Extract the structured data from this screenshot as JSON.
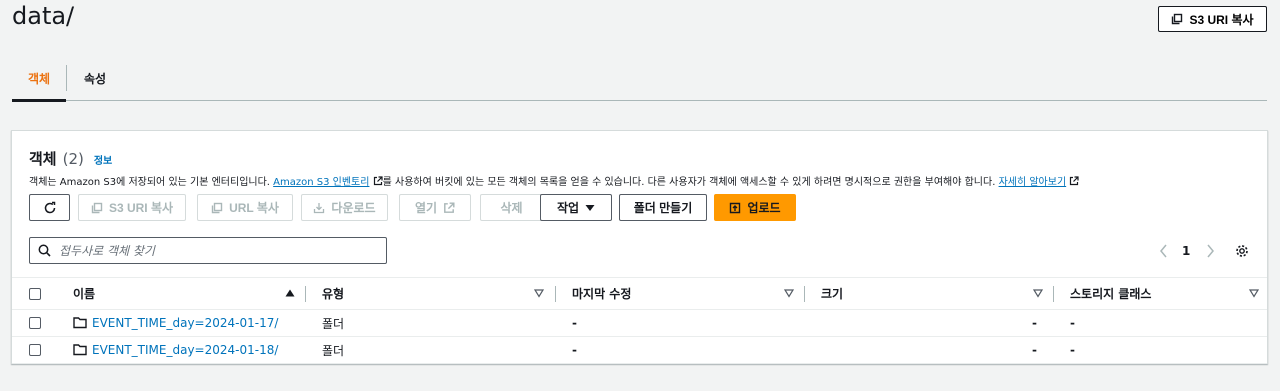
{
  "header": {
    "title": "data/",
    "copy_uri_label": "S3 URI 복사"
  },
  "tabs": [
    {
      "label": "객체",
      "active": true
    },
    {
      "label": "속성",
      "active": false
    }
  ],
  "objects_panel": {
    "title": "객체",
    "count": "(2)",
    "info_label": "정보",
    "description_prefix": "객체는 Amazon S3에 저장되어 있는 기본 엔터티입니다. ",
    "inventory_link": "Amazon S3 인벤토리",
    "description_mid": "를 사용하여 버킷에 있는 모든 객체의 목록을 얻을 수 있습니다. 다른 사용자가 객체에 액세스할 수 있게 하려면 명시적으로 권한을 부여해야 합니다. ",
    "learn_more_link": "자세히 알아보기"
  },
  "toolbar": {
    "copy_s3_uri": "S3 URI 복사",
    "copy_url": "URL 복사",
    "download": "다운로드",
    "open": "열기",
    "delete": "삭제",
    "actions": "작업",
    "create_folder": "폴더 만들기",
    "upload": "업로드"
  },
  "search": {
    "placeholder": "접두사로 객체 찾기"
  },
  "pagination": {
    "current_page": "1"
  },
  "table": {
    "columns": [
      "이름",
      "유형",
      "마지막 수정",
      "크기",
      "스토리지 클래스"
    ],
    "rows": [
      {
        "name": "EVENT_TIME_day=2024-01-17/",
        "type": "폴더",
        "last_modified": "-",
        "size": "-",
        "storage_class": "-"
      },
      {
        "name": "EVENT_TIME_day=2024-01-18/",
        "type": "폴더",
        "last_modified": "-",
        "size": "-",
        "storage_class": "-"
      }
    ]
  },
  "colors": {
    "accent": "#ec7211",
    "primary_button": "#ff9900",
    "link": "#0073bb"
  }
}
